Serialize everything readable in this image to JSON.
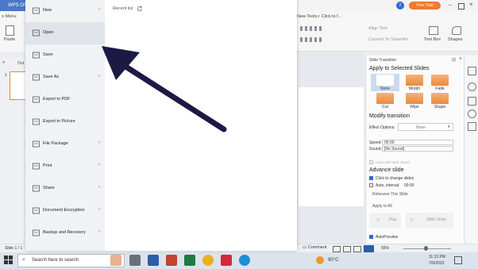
{
  "window": {
    "tab_label": "WPS Of",
    "free_trial": "Free Trial",
    "avatar_letter": "2"
  },
  "ribbon": {
    "menu_label": "Menu",
    "paste_label": "Paste",
    "new_tools_label": "New Tools",
    "click_to_find": "Click to f...",
    "align_text": "Align Text",
    "convert_smartart": "Convert To SmartArt",
    "text_box": "Text Box",
    "shapes": "Shapes"
  },
  "file_menu": {
    "items": [
      {
        "label": "New",
        "icon": "new-file-icon",
        "has_arrow": true
      },
      {
        "label": "Open",
        "icon": "open-folder-icon",
        "has_arrow": false,
        "active": true
      },
      {
        "label": "Save",
        "icon": "save-icon",
        "has_arrow": false
      },
      {
        "label": "Save As",
        "icon": "save-as-icon",
        "has_arrow": true
      },
      {
        "label": "Export to PDF",
        "icon": "pdf-icon",
        "has_arrow": false
      },
      {
        "label": "Export to Picture",
        "icon": "picture-icon",
        "has_arrow": false
      },
      {
        "label": "File Package",
        "icon": "file-package-icon",
        "has_arrow": true
      },
      {
        "label": "Print",
        "icon": "print-icon",
        "has_arrow": true
      },
      {
        "label": "Share",
        "icon": "share-icon",
        "has_arrow": true
      },
      {
        "label": "Document Encryption",
        "icon": "lock-icon",
        "has_arrow": true
      },
      {
        "label": "Backup and Recovery",
        "icon": "backup-icon",
        "has_arrow": true
      }
    ],
    "recent_label": "Recent list"
  },
  "slides": {
    "outline_tab": "Out",
    "slide_number": "1"
  },
  "panel": {
    "title": "Slide Transition",
    "apply_title": "Apply to Selected Slides",
    "effects": [
      "None",
      "Morph",
      "Fade",
      "Cut",
      "Wipe",
      "Shape"
    ],
    "modify_title": "Modify transition",
    "effect_options_label": "Effect Options:",
    "effect_options_value": "None",
    "speed_label": "Speed:",
    "speed_value": "00.50",
    "sound_label": "Sound:",
    "sound_value": "[No Sound]",
    "loop_label": "Loop until next sound",
    "advance_title": "Advance slide",
    "click_label": "Click to change slides",
    "auto_label": "Auto, interval:",
    "auto_value": "00:00",
    "rehearse_label": "Rehearse This Slide",
    "apply_all_label": "Apply to All",
    "play_label": "Play",
    "slideshow_label": "Slide Show",
    "autopreview_label": "AutoPreview"
  },
  "status": {
    "slide_info": "Slide 1 / 1",
    "comment_label": "Comment",
    "zoom": "65%"
  },
  "taskbar": {
    "search_placeholder": "Search here to search",
    "temperature": "90°C",
    "time": "11:13 PM",
    "date": "7/9/2023"
  },
  "colors": {
    "accent": "#4a78c6",
    "arrow": "#1c1a45",
    "effect_orange": "#ee9a55"
  }
}
